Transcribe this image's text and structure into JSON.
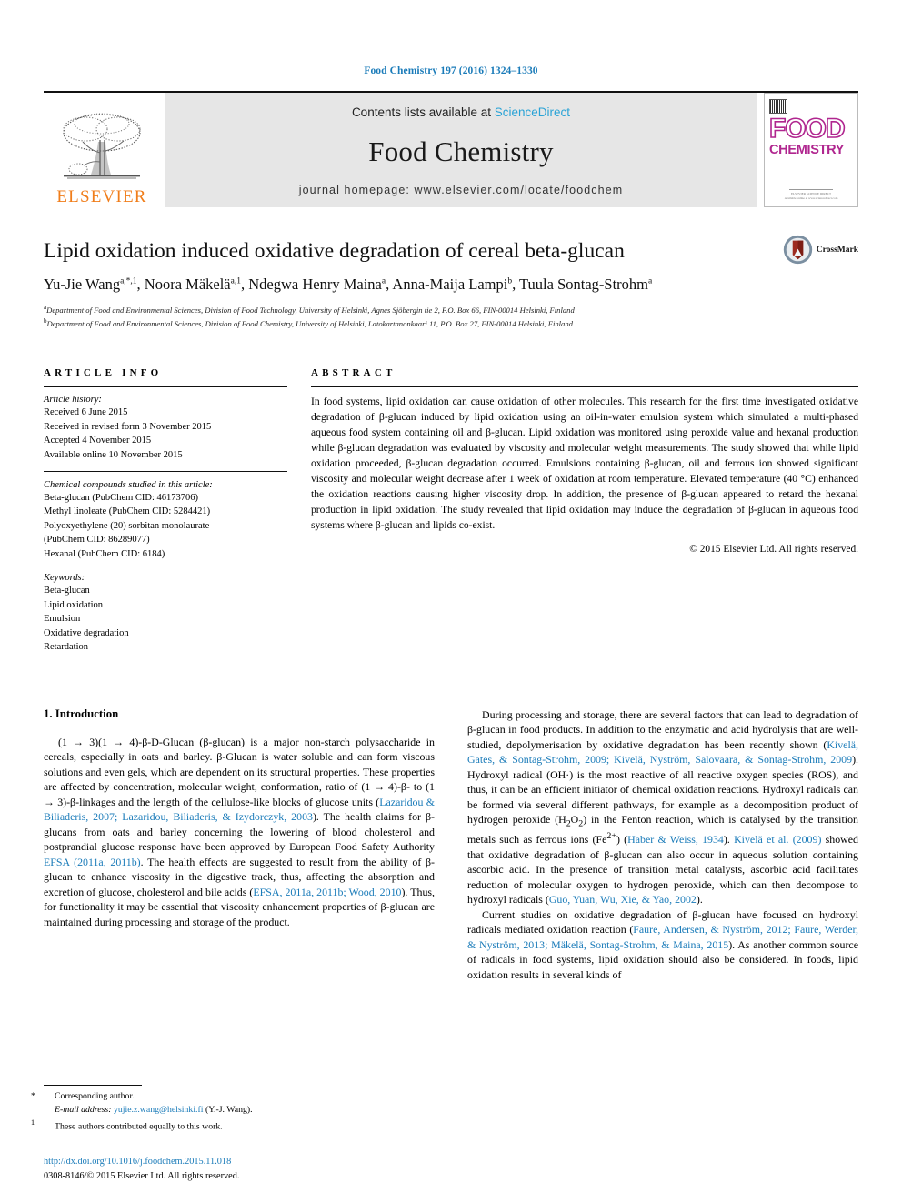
{
  "running_head": "Food Chemistry 197 (2016) 1324–1330",
  "masthead": {
    "publisher_name": "ELSEVIER",
    "contents_prefix": "Contents lists available at ",
    "contents_link": "ScienceDirect",
    "journal_title": "Food Chemistry",
    "homepage": "journal homepage: www.elsevier.com/locate/foodchem",
    "cover": {
      "word_top": "FOOD",
      "word_bottom": "CHEMISTRY",
      "footer_line1": "ELSEVIER SCIENCE DIRECT",
      "footer_line2": "Available online at www.sciencedirect.com"
    },
    "accent_link_color": "#2aa3d6",
    "elsevier_orange": "#f07d1a",
    "cover_magenta": "#b0268f"
  },
  "article": {
    "title": "Lipid oxidation induced oxidative degradation of cereal beta-glucan",
    "crossmark_label": "CrossMark",
    "authors": [
      {
        "name": "Yu-Jie Wang",
        "sup": "a,*,1"
      },
      {
        "name": "Noora Mäkelä",
        "sup": "a,1"
      },
      {
        "name": "Ndegwa Henry Maina",
        "sup": "a"
      },
      {
        "name": "Anna-Maija Lampi",
        "sup": "b"
      },
      {
        "name": "Tuula Sontag-Strohm",
        "sup": "a"
      }
    ],
    "affiliations": [
      {
        "mark": "a",
        "text": "Department of Food and Environmental Sciences, Division of Food Technology, University of Helsinki, Agnes Sjöbergin tie 2, P.O. Box 66, FIN-00014 Helsinki, Finland"
      },
      {
        "mark": "b",
        "text": "Department of Food and Environmental Sciences, Division of Food Chemistry, University of Helsinki, Latokartanonkaari 11, P.O. Box 27, FIN-00014 Helsinki, Finland"
      }
    ]
  },
  "article_info": {
    "heading": "ARTICLE INFO",
    "history_label": "Article history:",
    "history": [
      "Received 6 June 2015",
      "Received in revised form 3 November 2015",
      "Accepted 4 November 2015",
      "Available online 10 November 2015"
    ],
    "compounds_label": "Chemical compounds studied in this article:",
    "compounds": [
      "Beta-glucan (PubChem CID: 46173706)",
      "Methyl linoleate (PubChem CID: 5284421)",
      "Polyoxyethylene (20) sorbitan monolaurate",
      "(PubChem CID: 86289077)",
      "Hexanal (PubChem CID: 6184)"
    ],
    "keywords_label": "Keywords:",
    "keywords": [
      "Beta-glucan",
      "Lipid oxidation",
      "Emulsion",
      "Oxidative degradation",
      "Retardation"
    ]
  },
  "abstract": {
    "heading": "ABSTRACT",
    "text": "In food systems, lipid oxidation can cause oxidation of other molecules. This research for the first time investigated oxidative degradation of β-glucan induced by lipid oxidation using an oil-in-water emulsion system which simulated a multi-phased aqueous food system containing oil and β-glucan. Lipid oxidation was monitored using peroxide value and hexanal production while β-glucan degradation was evaluated by viscosity and molecular weight measurements. The study showed that while lipid oxidation proceeded, β-glucan degradation occurred. Emulsions containing β-glucan, oil and ferrous ion showed significant viscosity and molecular weight decrease after 1 week of oxidation at room temperature. Elevated temperature (40 °C) enhanced the oxidation reactions causing higher viscosity drop. In addition, the presence of β-glucan appeared to retard the hexanal production in lipid oxidation. The study revealed that lipid oxidation may induce the degradation of β-glucan in aqueous food systems where β-glucan and lipids co-exist.",
    "copyright": "© 2015 Elsevier Ltd. All rights reserved."
  },
  "introduction": {
    "heading": "1. Introduction",
    "left_p1_a": "(1 → 3)(1 → 4)-β-",
    "left_p1_b": "D",
    "left_p1_c": "-Glucan (β-glucan) is a major non-starch polysaccharide in cereals, especially in oats and barley. β-Glucan is water soluble and can form viscous solutions and even gels, which are dependent on its structural properties. These properties are affected by concentration, molecular weight, conformation, ratio of (1 → 4)-β- to (1 → 3)-β-linkages and the length of the cellulose-like blocks of glucose units (",
    "ref1": "Lazaridou & Biliaderis, 2007; Lazaridou, Biliaderis, & Izydorczyk, 2003",
    "left_p1_d": "). The health claims for β-glucans from oats and barley concerning the lowering of blood cholesterol and postprandial glucose response have been approved by European Food Safety Authority ",
    "ref2": "EFSA (2011a, 2011b)",
    "left_p1_e": ". The health effects are suggested to result from the ability of β-glucan to enhance viscosity in the digestive track, thus, affecting the absorption and excretion of glucose, cholesterol and bile acids (",
    "ref3": "EFSA, 2011a, 2011b; Wood, 2010",
    "left_p1_f": "). Thus, for functionality it may be essential that viscosity enhancement properties of β-glucan are maintained during processing and storage of the product.",
    "right_p1_a": "During processing and storage, there are several factors that can lead to degradation of β-glucan in food products. In addition to the enzymatic and acid hydrolysis that are well-studied, depolymerisation by oxidative degradation has been recently shown (",
    "ref4": "Kivelä, Gates, & Sontag-Strohm, 2009; Kivelä, Nyström, Salovaara, & Sontag-Strohm, 2009",
    "right_p1_b": "). Hydroxyl radical (OH·) is the most reactive of all reactive oxygen species (ROS), and thus, it can be an efficient initiator of chemical oxidation reactions. Hydroxyl radicals can be formed via several different pathways, for example as a decomposition product of hydrogen peroxide (H",
    "right_p1_sub1": "2",
    "right_p1_c": "O",
    "right_p1_sub2": "2",
    "right_p1_d": ") in the Fenton reaction, which is catalysed by the transition metals such as ferrous ions (Fe",
    "right_p1_sup": "2+",
    "right_p1_e": ") (",
    "ref5": "Haber & Weiss, 1934",
    "right_p1_f": "). ",
    "ref6": "Kivelä et al. (2009)",
    "right_p1_g": " showed that oxidative degradation of β-glucan can also occur in aqueous solution containing ascorbic acid. In the presence of transition metal catalysts, ascorbic acid facilitates reduction of molecular oxygen to hydrogen peroxide, which can then decompose to hydroxyl radicals (",
    "ref7": "Guo, Yuan, Wu, Xie, & Yao, 2002",
    "right_p1_h": ").",
    "right_p2_a": "Current studies on oxidative degradation of β-glucan have focused on hydroxyl radicals mediated oxidation reaction (",
    "ref8": "Faure, Andersen, & Nyström, 2012; Faure, Werder, & Nyström, 2013; Mäkelä, Sontag-Strohm, & Maina, 2015",
    "right_p2_b": "). As another common source of radicals in food systems, lipid oxidation should also be considered. In foods, lipid oxidation results in several kinds of"
  },
  "footnotes": {
    "corresponding": "Corresponding author.",
    "email_label": "E-mail address:",
    "email": "yujie.z.wang@helsinki.fi",
    "email_suffix": "(Y.-J. Wang).",
    "equal_contrib_mark": "1",
    "equal_contrib": "These authors contributed equally to this work.",
    "doi": "http://dx.doi.org/10.1016/j.foodchem.2015.11.018",
    "issn": "0308-8146/© 2015 Elsevier Ltd. All rights reserved."
  }
}
